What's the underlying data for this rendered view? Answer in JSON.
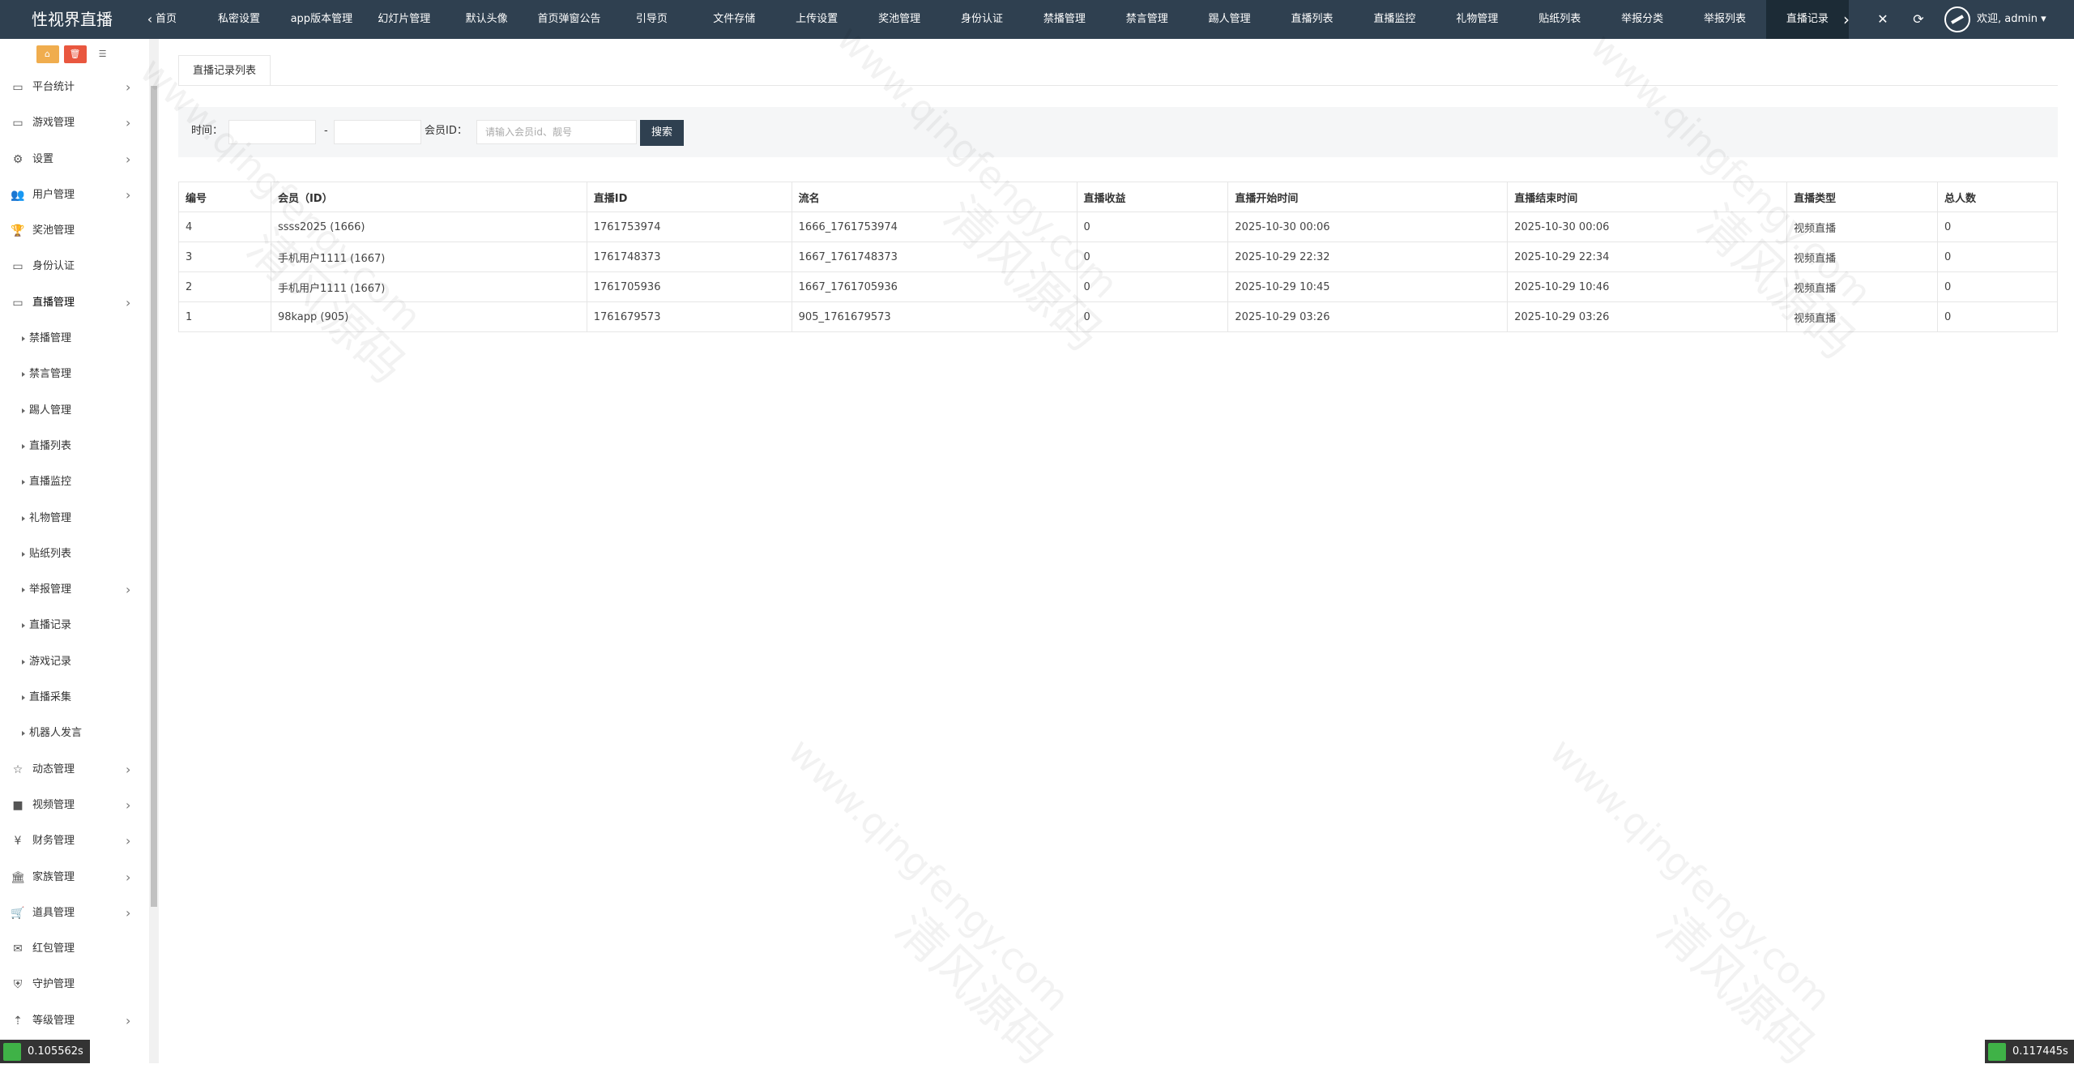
{
  "app": {
    "title": "性视界直播"
  },
  "topbar": {
    "prev_icon": "chevron-left-icon",
    "tabs": [
      {
        "label": "首页",
        "active": false
      },
      {
        "label": "私密设置",
        "active": false
      },
      {
        "label": "app版本管理",
        "active": false
      },
      {
        "label": "幻灯片管理",
        "active": false
      },
      {
        "label": "默认头像",
        "active": false
      },
      {
        "label": "首页弹窗公告",
        "active": false
      },
      {
        "label": "引导页",
        "active": false
      },
      {
        "label": "文件存储",
        "active": false
      },
      {
        "label": "上传设置",
        "active": false
      },
      {
        "label": "奖池管理",
        "active": false
      },
      {
        "label": "身份认证",
        "active": false
      },
      {
        "label": "禁播管理",
        "active": false
      },
      {
        "label": "禁言管理",
        "active": false
      },
      {
        "label": "踢人管理",
        "active": false
      },
      {
        "label": "直播列表",
        "active": false
      },
      {
        "label": "直播监控",
        "active": false
      },
      {
        "label": "礼物管理",
        "active": false
      },
      {
        "label": "贴纸列表",
        "active": false
      },
      {
        "label": "举报分类",
        "active": false
      },
      {
        "label": "举报列表",
        "active": false
      },
      {
        "label": "直播记录",
        "active": true
      }
    ],
    "user_label": "欢迎, admin ▾"
  },
  "sidebar": {
    "items": [
      {
        "label": "平台统计",
        "icon": "monitor-icon",
        "glyph": "▭",
        "chev": true,
        "sub": false
      },
      {
        "label": "游戏管理",
        "icon": "monitor-icon",
        "glyph": "▭",
        "chev": true,
        "sub": false
      },
      {
        "label": "设置",
        "icon": "gear-icon",
        "glyph": "⚙",
        "chev": true,
        "sub": false
      },
      {
        "label": "用户管理",
        "icon": "users-icon",
        "glyph": "👥",
        "chev": true,
        "sub": false
      },
      {
        "label": "奖池管理",
        "icon": "trophy-icon",
        "glyph": "🏆",
        "chev": false,
        "sub": false
      },
      {
        "label": "身份认证",
        "icon": "monitor-icon",
        "glyph": "▭",
        "chev": false,
        "sub": false
      },
      {
        "label": "直播管理",
        "icon": "monitor-icon",
        "glyph": "▭",
        "chev": true,
        "sub": false,
        "active": true
      },
      {
        "label": "禁播管理",
        "sub": true
      },
      {
        "label": "禁言管理",
        "sub": true
      },
      {
        "label": "踢人管理",
        "sub": true
      },
      {
        "label": "直播列表",
        "sub": true
      },
      {
        "label": "直播监控",
        "sub": true
      },
      {
        "label": "礼物管理",
        "sub": true
      },
      {
        "label": "贴纸列表",
        "sub": true
      },
      {
        "label": "举报管理",
        "sub": true,
        "chev": true
      },
      {
        "label": "直播记录",
        "sub": true
      },
      {
        "label": "游戏记录",
        "sub": true
      },
      {
        "label": "直播采集",
        "sub": true
      },
      {
        "label": "机器人发言",
        "sub": true
      },
      {
        "label": "动态管理",
        "icon": "star-icon",
        "glyph": "☆",
        "chev": true,
        "sub": false
      },
      {
        "label": "视频管理",
        "icon": "video-icon",
        "glyph": "■",
        "chev": true,
        "sub": false
      },
      {
        "label": "财务管理",
        "icon": "yen-icon",
        "glyph": "¥",
        "chev": true,
        "sub": false
      },
      {
        "label": "家族管理",
        "icon": "bank-icon",
        "glyph": "🏛",
        "chev": true,
        "sub": false
      },
      {
        "label": "道具管理",
        "icon": "cart-icon",
        "glyph": "🛒",
        "chev": true,
        "sub": false
      },
      {
        "label": "红包管理",
        "icon": "envelope-icon",
        "glyph": "✉",
        "chev": false,
        "sub": false
      },
      {
        "label": "守护管理",
        "icon": "shield-icon",
        "glyph": "⛨",
        "chev": false,
        "sub": false
      },
      {
        "label": "等级管理",
        "icon": "level-icon",
        "glyph": "⇡",
        "chev": true,
        "sub": false
      }
    ]
  },
  "main": {
    "page_tab": "直播记录列表",
    "search": {
      "time_label": "时间：",
      "dash": "-",
      "member_label": "会员ID：",
      "member_placeholder": "请输入会员id、靓号",
      "button": "搜索"
    },
    "table": {
      "columns": [
        "编号",
        "会员（ID）",
        "直播ID",
        "流名",
        "直播收益",
        "直播开始时间",
        "直播结束时间",
        "直播类型",
        "总人数"
      ],
      "rows": [
        [
          "4",
          "ssss2025 (1666)",
          "1761753974",
          "1666_1761753974",
          "0",
          "2025-10-30 00:06",
          "2025-10-30 00:06",
          "视频直播",
          "0"
        ],
        [
          "3",
          "手机用户1111 (1667)",
          "1761748373",
          "1667_1761748373",
          "0",
          "2025-10-29 22:32",
          "2025-10-29 22:34",
          "视频直播",
          "0"
        ],
        [
          "2",
          "手机用户1111 (1667)",
          "1761705936",
          "1667_1761705936",
          "0",
          "2025-10-29 10:45",
          "2025-10-29 10:46",
          "视频直播",
          "0"
        ],
        [
          "1",
          "98kapp (905)",
          "1761679573",
          "905_1761679573",
          "0",
          "2025-10-29 03:26",
          "2025-10-29 03:26",
          "视频直播",
          "0"
        ]
      ]
    }
  },
  "timers": {
    "left": "0.105562s",
    "right": "0.117445s"
  },
  "watermark": {
    "url_text": "www.qingfengy.com",
    "cn_text": "清风源码"
  },
  "colors": {
    "topbar": "#2f4050",
    "active_tab": "#1c2b36",
    "home_btn": "#f0ad4e",
    "red_btn": "#e9573f",
    "gray_btn": "#999999"
  }
}
